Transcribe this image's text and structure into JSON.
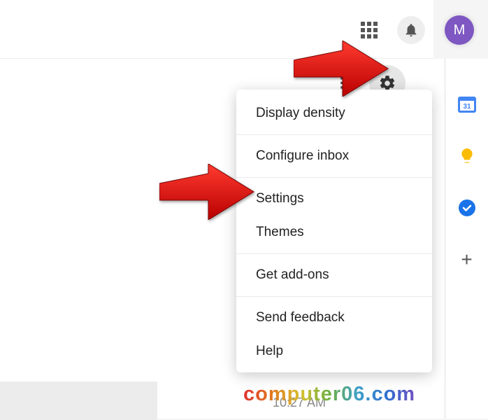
{
  "topbar": {
    "avatar_initial": "M"
  },
  "menu": {
    "display_density": "Display density",
    "configure_inbox": "Configure inbox",
    "settings": "Settings",
    "themes": "Themes",
    "get_addons": "Get add-ons",
    "send_feedback": "Send feedback",
    "help": "Help"
  },
  "side": {
    "calendar_day": "31"
  },
  "footer": {
    "timestamp": "10:27 AM"
  },
  "watermark": "computer06.com"
}
